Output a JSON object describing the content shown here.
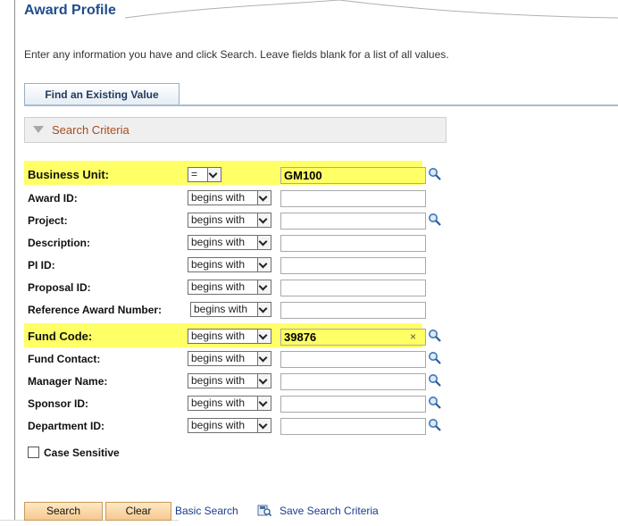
{
  "page": {
    "title": "Award Profile",
    "instructions": "Enter any information you have and click Search. Leave fields blank for a list of all values."
  },
  "tabs": [
    {
      "label": "Find an Existing Value",
      "active": true
    }
  ],
  "search_criteria": {
    "header": "Search Criteria",
    "fields": [
      {
        "label": "Business Unit:",
        "operator": "=",
        "value": "GM100",
        "highlighted": true,
        "lookup": true,
        "clear": false
      },
      {
        "label": "Award ID:",
        "operator": "begins with",
        "value": "",
        "highlighted": false,
        "lookup": false,
        "clear": false
      },
      {
        "label": "Project:",
        "operator": "begins with",
        "value": "",
        "highlighted": false,
        "lookup": true,
        "clear": false
      },
      {
        "label": "Description:",
        "operator": "begins with",
        "value": "",
        "highlighted": false,
        "lookup": false,
        "clear": false
      },
      {
        "label": "PI ID:",
        "operator": "begins with",
        "value": "",
        "highlighted": false,
        "lookup": false,
        "clear": false
      },
      {
        "label": "Proposal ID:",
        "operator": "begins with",
        "value": "",
        "highlighted": false,
        "lookup": false,
        "clear": false
      },
      {
        "label": "Reference Award Number:",
        "operator": "begins with",
        "value": "",
        "highlighted": false,
        "lookup": false,
        "clear": false
      },
      {
        "label": "Fund Code:",
        "operator": "begins with",
        "value": "39876",
        "highlighted": true,
        "lookup": true,
        "clear": true
      },
      {
        "label": "Fund Contact:",
        "operator": "begins with",
        "value": "",
        "highlighted": false,
        "lookup": true,
        "clear": false
      },
      {
        "label": "Manager Name:",
        "operator": "begins with",
        "value": "",
        "highlighted": false,
        "lookup": true,
        "clear": false
      },
      {
        "label": "Sponsor ID:",
        "operator": "begins with",
        "value": "",
        "highlighted": false,
        "lookup": true,
        "clear": false
      },
      {
        "label": "Department ID:",
        "operator": "begins with",
        "value": "",
        "highlighted": false,
        "lookup": true,
        "clear": false
      }
    ],
    "case_sensitive": {
      "label": "Case Sensitive",
      "checked": false
    }
  },
  "actions": {
    "search_label": "Search",
    "clear_label": "Clear",
    "basic_search_label": "Basic Search",
    "save_search_label": "Save Search Criteria"
  },
  "icons": {
    "lookup": "magnifier-icon",
    "clear": "clear-x-icon",
    "save_search": "save-search-criteria-icon",
    "dropdown": "chevron-down-icon",
    "collapse": "triangle-down-icon"
  },
  "colors": {
    "title": "#1f4d8b",
    "criteria_header_text": "#a84b1c",
    "highlight": "#ffff66",
    "button_top": "#fde9c4",
    "button_bottom": "#f6c88f",
    "link": "#1a3d8c"
  }
}
